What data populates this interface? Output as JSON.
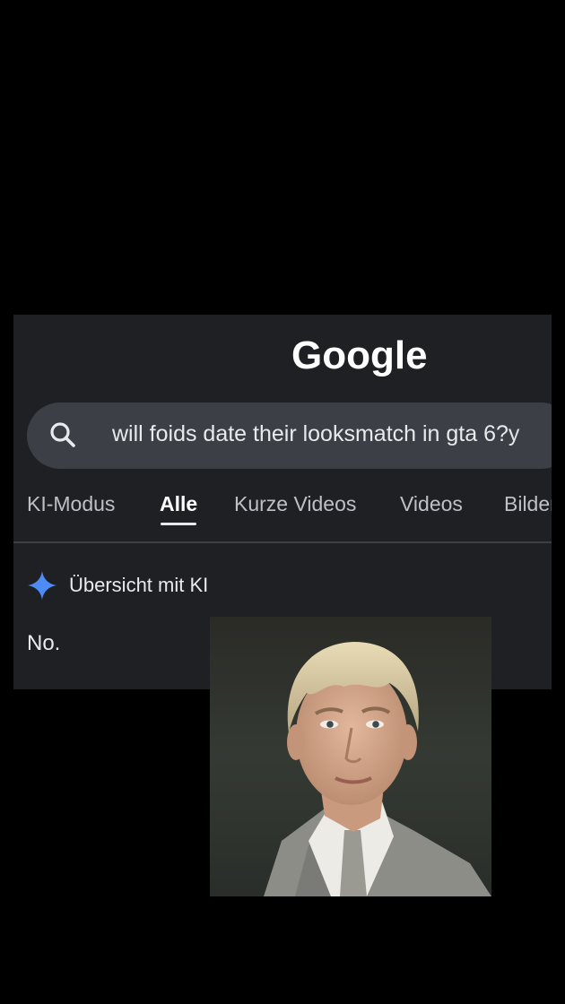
{
  "google": {
    "logo_text": "Google",
    "search": {
      "query": "will foids date their looksmatch in gta 6?y",
      "icon": "search-icon"
    },
    "tabs": [
      {
        "label": "KI-Modus",
        "active": false
      },
      {
        "label": "Alle",
        "active": true
      },
      {
        "label": "Kurze Videos",
        "active": false
      },
      {
        "label": "Videos",
        "active": false
      },
      {
        "label": "Bilder",
        "active": false
      }
    ],
    "ai_overview": {
      "icon": "sparkle-icon",
      "heading": "Übersicht mit KI",
      "answer": "No."
    }
  },
  "overlay_image": {
    "subject": "portrait-photo"
  },
  "colors": {
    "page_background": "#000000",
    "panel_background": "#1f2023",
    "search_background": "#3c3f45",
    "text_primary": "#e8eaed",
    "text_secondary": "#bdc1c6",
    "sparkle_blue": "#4d8cf5"
  }
}
